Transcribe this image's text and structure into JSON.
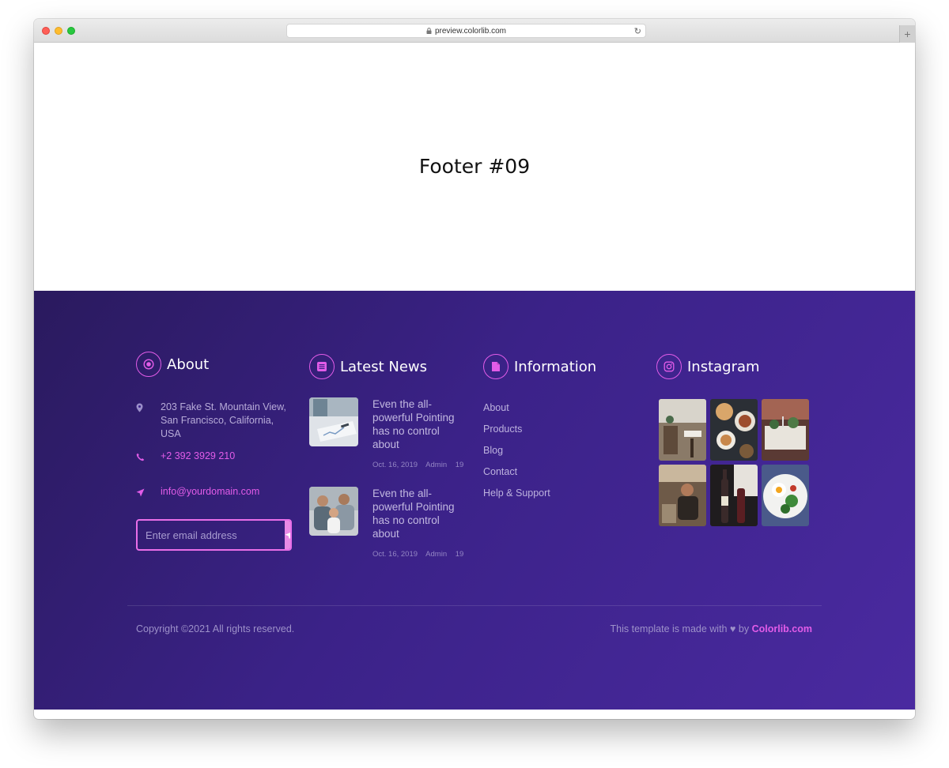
{
  "browser": {
    "url": "preview.colorlib.com",
    "new_tab_label": "+"
  },
  "hero": {
    "title": "Footer #09"
  },
  "colors": {
    "accent": "#e25ce8",
    "footer_bg_start": "#2a1a5e",
    "footer_bg_end": "#4a2aa0",
    "send_button": "#e98ae6"
  },
  "about": {
    "title": "About",
    "icon": "target-icon",
    "address": "203 Fake St. Mountain View, San Francisco, California, USA",
    "phone": "+2 392 3929 210",
    "email": "info@yourdomain.com",
    "subscribe_placeholder": "Enter email address"
  },
  "news": {
    "title": "Latest News",
    "icon": "news-list-icon",
    "items": [
      {
        "title": "Even the all-powerful Pointing has no control about",
        "date": "Oct. 16, 2019",
        "author": "Admin",
        "comments": "19"
      },
      {
        "title": "Even the all-powerful Pointing has no control about",
        "date": "Oct. 16, 2019",
        "author": "Admin",
        "comments": "19"
      }
    ]
  },
  "information": {
    "title": "Information",
    "icon": "document-icon",
    "links": [
      "About",
      "Products",
      "Blog",
      "Contact",
      "Help & Support"
    ]
  },
  "instagram": {
    "title": "Instagram",
    "icon": "instagram-icon"
  },
  "bottom": {
    "copyright": "Copyright ©2021 All rights reserved.",
    "made_with_prefix": "This template is made with",
    "made_with_by": "by",
    "brand": "Colorlib.com"
  }
}
